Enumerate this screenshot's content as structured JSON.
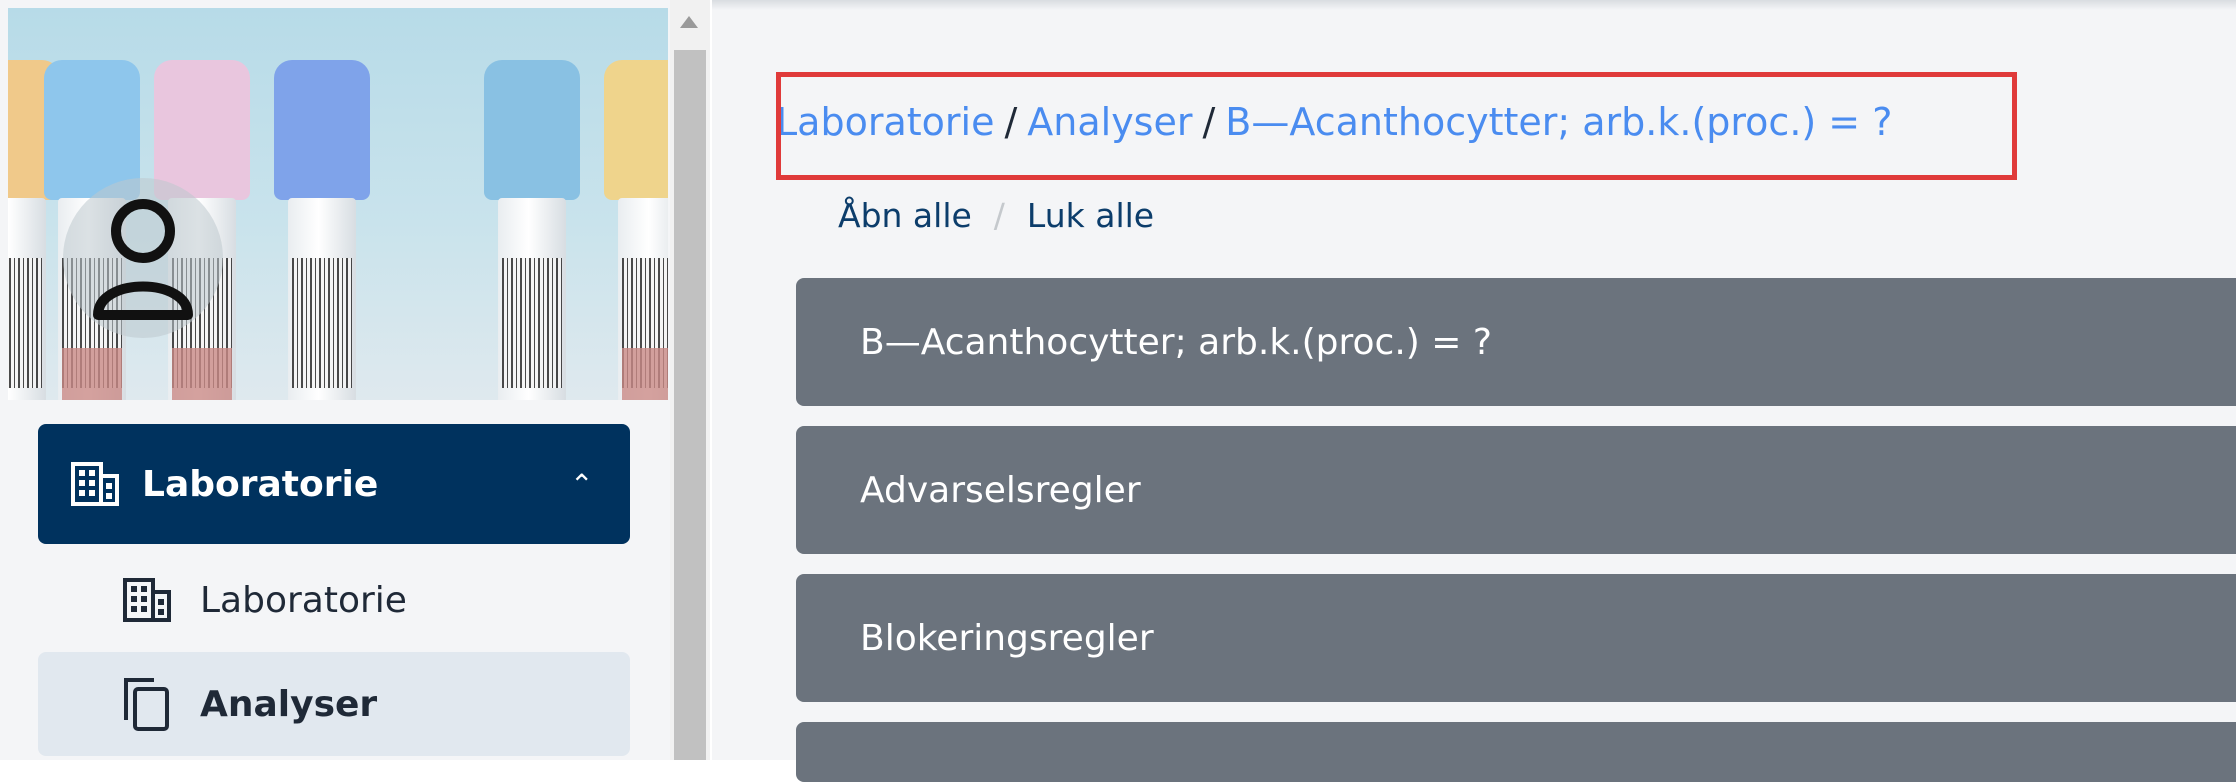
{
  "sidebar": {
    "group": {
      "label": "Laboratorie",
      "icon": "building-icon",
      "chevron": "chevron-up-icon"
    },
    "items": [
      {
        "label": "Laboratorie",
        "icon": "building-icon",
        "active": false
      },
      {
        "label": "Analyser",
        "icon": "copy-icon",
        "active": true
      }
    ],
    "avatar_icon": "user-icon"
  },
  "breadcrumb": {
    "parts": [
      "Laboratorie",
      "Analyser",
      "B—Acanthocytter; arb.k.(proc.) = ?"
    ],
    "separator": "/"
  },
  "toggles": {
    "open_all": "Åbn alle",
    "close_all": "Luk alle",
    "divider": "/"
  },
  "panels": [
    {
      "title": "B—Acanthocytter; arb.k.(proc.) = ?"
    },
    {
      "title": "Advarselsregler"
    },
    {
      "title": "Blokeringsregler"
    },
    {
      "title": ""
    }
  ],
  "colors": {
    "nav_active": "#00325e",
    "breadcrumb_link": "#4a8cf0",
    "panel_bg": "#6b737d",
    "highlight": "#e03a3a"
  }
}
